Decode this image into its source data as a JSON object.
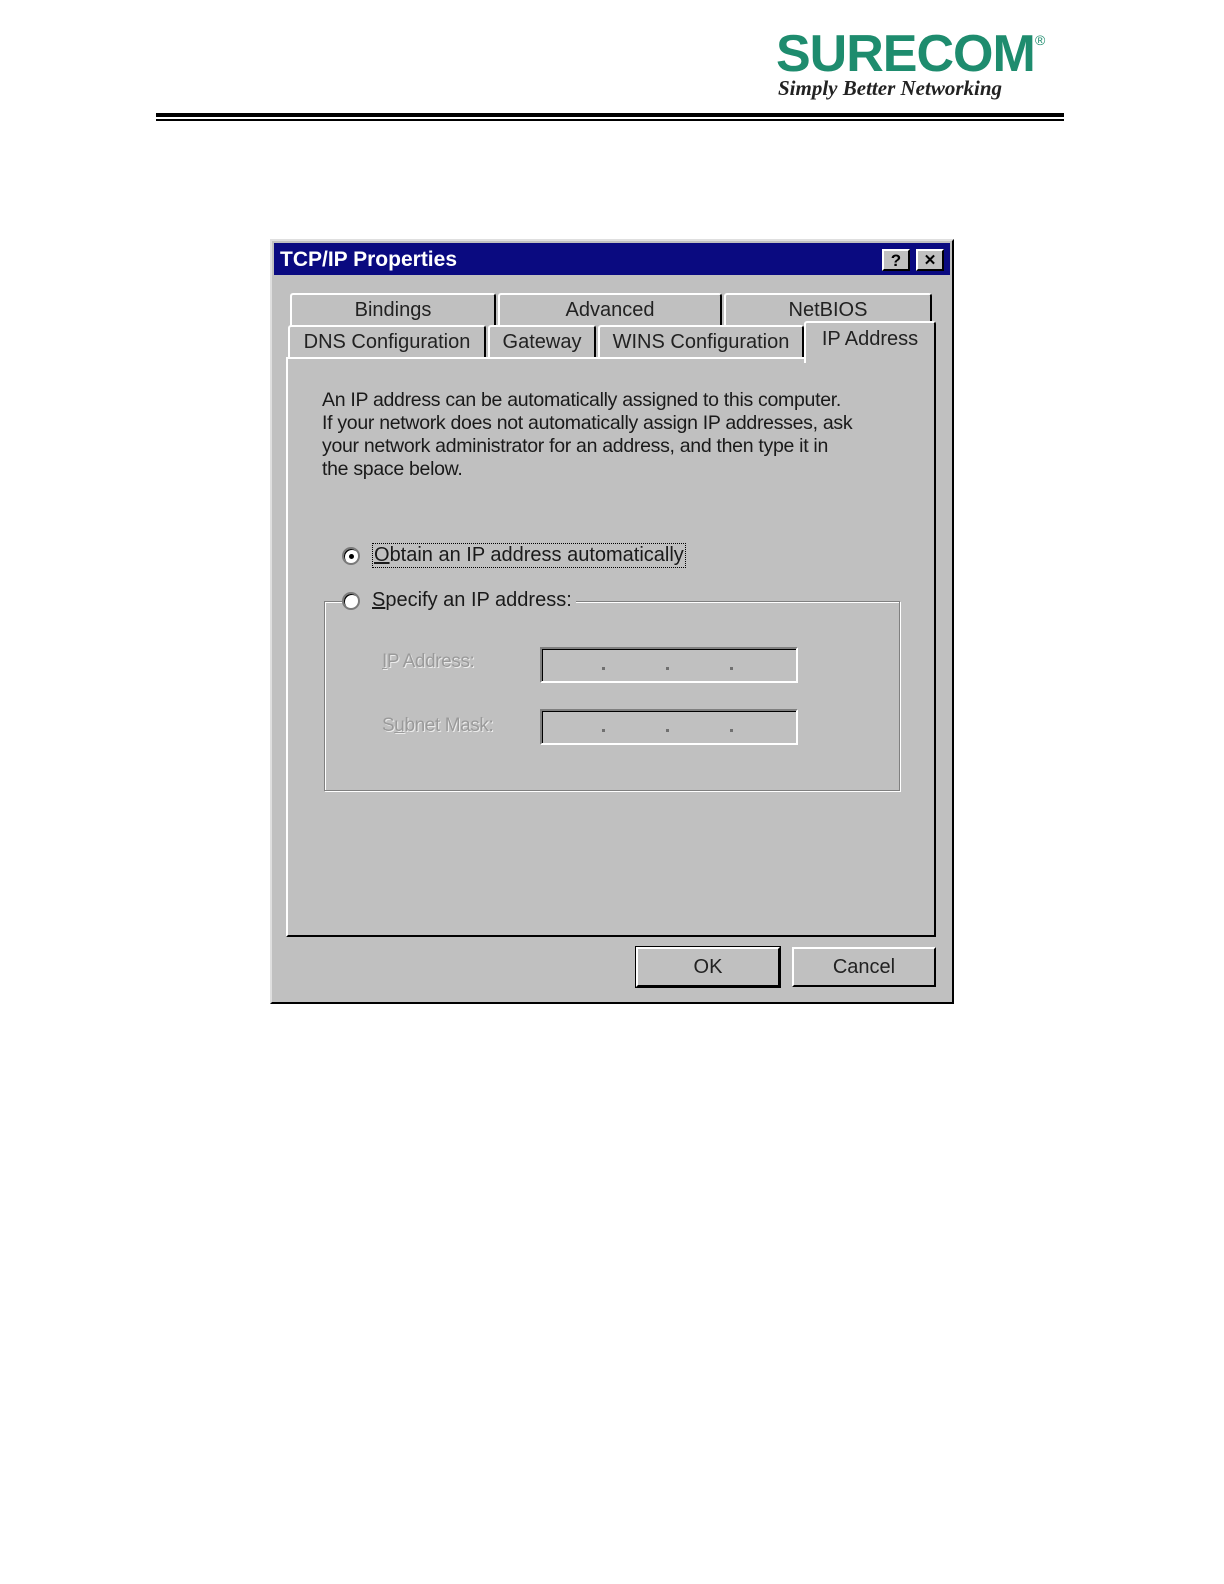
{
  "header": {
    "brand": "SURECOM",
    "registered_mark": "®",
    "tagline": "Simply Better Networking",
    "brand_color": "#1e8c6e"
  },
  "dialog": {
    "title": "TCP/IP Properties",
    "help_button": "?",
    "close_button": "✕",
    "tabs_row1": [
      "Bindings",
      "Advanced",
      "NetBIOS"
    ],
    "tabs_row2": [
      "DNS Configuration",
      "Gateway",
      "WINS Configuration",
      "IP Address"
    ],
    "active_tab": "IP Address",
    "intro_lines": [
      "An IP address can be automatically assigned to this computer.",
      "If your network does not automatically assign IP addresses, ask",
      "your network administrator for an address, and then type it in",
      "the space below."
    ],
    "option_auto": {
      "underlined": "O",
      "rest": "btain an IP address automatically",
      "selected": true
    },
    "option_specify": {
      "underlined": "S",
      "rest": "pecify an IP address:",
      "selected": false
    },
    "ip_address_label": {
      "pre": "",
      "underlined": "I",
      "rest": "P Address:"
    },
    "subnet_mask_label": {
      "pre": "S",
      "underlined": "u",
      "rest": "bnet Mask:"
    },
    "ip_address_value": "",
    "subnet_mask_value": "",
    "ok_label": "OK",
    "cancel_label": "Cancel",
    "titlebar_color": "#0a0a80"
  }
}
